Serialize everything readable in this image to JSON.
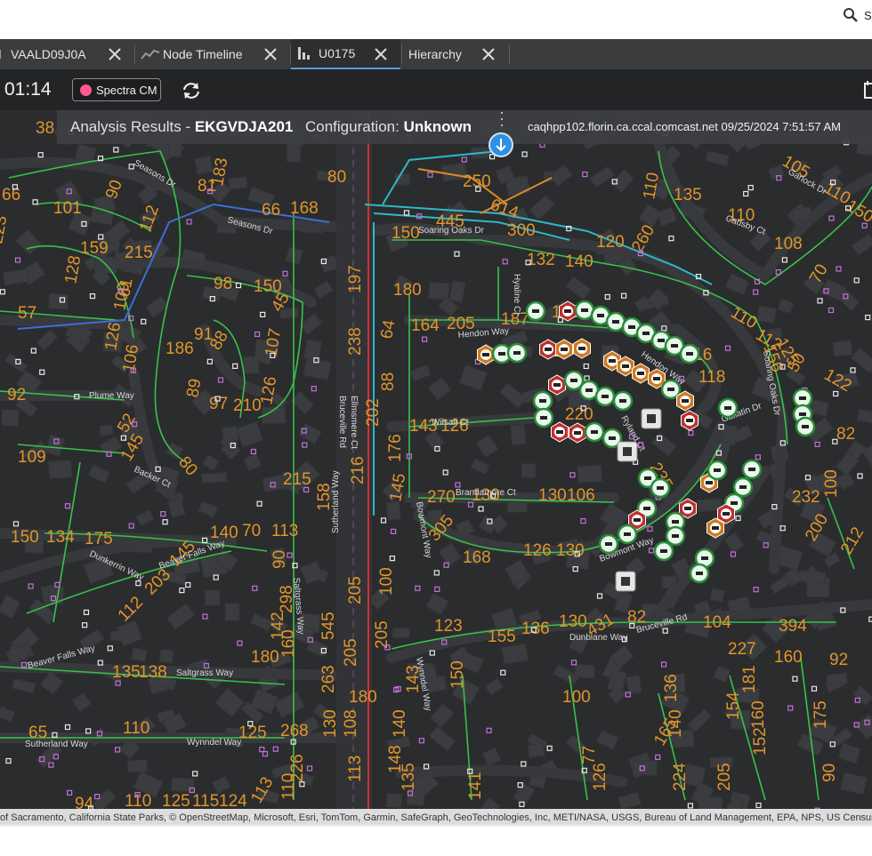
{
  "search": {
    "text": "S"
  },
  "tabs": [
    {
      "label": "VAALD09J0A",
      "icon": "document-icon"
    },
    {
      "label": "Node Timeline",
      "icon": "line-chart-icon"
    },
    {
      "label": "U0175",
      "icon": "bar-chart-icon",
      "active": true
    },
    {
      "label": "Hierarchy",
      "icon": ""
    }
  ],
  "toolbar": {
    "time": "01:14",
    "spectra_label": "Spectra CM",
    "spectra_color": "#ff5a8a",
    "refresh_icon": "refresh-icon",
    "calendar_icon": "calendar-icon"
  },
  "analysis": {
    "prefix": "Analysis Results - ",
    "id": "EKGVDJA201",
    "config_label": "Configuration: ",
    "config_value": "Unknown",
    "host_time": "caqhpp102.florin.ca.ccal.comcast.net 09/25/2024 7:51:57 AM"
  },
  "map": {
    "street_labels": [
      "Seasons Dr",
      "Seasons Dr",
      "Soaring Oaks Dr",
      "Hendon Way",
      "Hendon Way",
      "Plume Way",
      "Backer Ct",
      "Wilsall Ct",
      "Ryland Ct",
      "Gallatin Dr",
      "Soaring Oaks Dr",
      "Brandamore Ct",
      "Bowmont Way",
      "Bowmont Way",
      "Dunkerrin Way",
      "Beaver Falls Way",
      "Beaver Falls Way",
      "Saltgrass Way",
      "Saltgrass Way",
      "Sutherland Way",
      "Sutherland Way",
      "Wynndel Way",
      "Wynndel Way",
      "Dunblane Way",
      "Bruceville Rd",
      "Bruceville Rd",
      "Ellmsmere Ct",
      "Cadsby Ct",
      "Garlock Dr",
      "Hyaline Ct"
    ],
    "numbers": [
      "38",
      "66",
      "101",
      "223",
      "159",
      "215",
      "112",
      "90",
      "81",
      "183",
      "168",
      "66",
      "80",
      "250",
      "445",
      "614",
      "300",
      "150",
      "132",
      "140",
      "120",
      "260",
      "110",
      "135",
      "110",
      "108",
      "70",
      "105",
      "110",
      "150",
      "92",
      "57",
      "61",
      "109",
      "106",
      "126",
      "98",
      "150",
      "45",
      "128",
      "91",
      "88",
      "186",
      "107",
      "126",
      "89",
      "97",
      "210",
      "180",
      "164",
      "205",
      "64",
      "197",
      "238",
      "88",
      "202",
      "187",
      "126",
      "116",
      "118",
      "110",
      "112",
      "156",
      "125",
      "50",
      "122",
      "82",
      "52",
      "145",
      "80",
      "109",
      "215",
      "158",
      "216",
      "270",
      "130",
      "130",
      "106",
      "145",
      "176",
      "143",
      "126",
      "220",
      "235",
      "232",
      "100",
      "200",
      "212",
      "145",
      "150",
      "134",
      "175",
      "140",
      "70",
      "113",
      "90",
      "203",
      "145",
      "112",
      "298",
      "142",
      "545",
      "160",
      "263",
      "135",
      "138",
      "180",
      "205",
      "205",
      "180",
      "305",
      "168",
      "126",
      "130",
      "100",
      "130",
      "155",
      "136",
      "431",
      "82",
      "104",
      "394",
      "227",
      "160",
      "92",
      "65",
      "110",
      "125",
      "268",
      "130",
      "140",
      "143",
      "150",
      "135",
      "123",
      "100",
      "136",
      "140",
      "165",
      "181",
      "154",
      "160",
      "152",
      "175",
      "90",
      "94",
      "110",
      "125",
      "115",
      "124",
      "113",
      "110",
      "226",
      "113",
      "148",
      "141",
      "77",
      "126",
      "224",
      "205",
      "205",
      "108"
    ],
    "attribution": "of Sacramento, California State Parks, © OpenStreetMap, Microsoft, Esri, TomTom, Garmin, SafeGraph, GeoTechnologies, Inc, METI/NASA, USGS, Bureau of Land Management, EPA, NPS, US Census Bu"
  }
}
